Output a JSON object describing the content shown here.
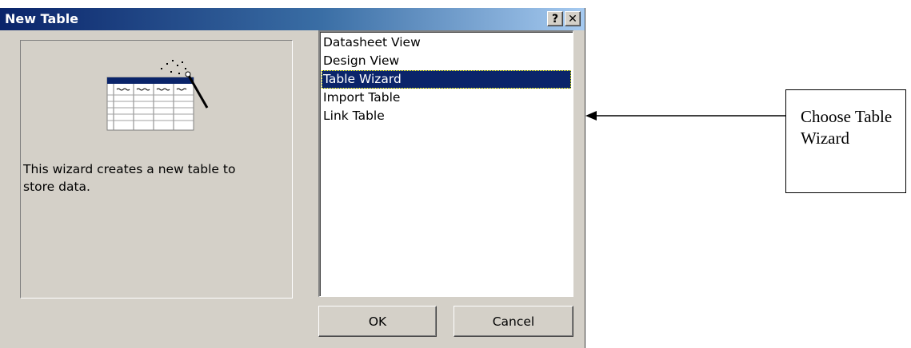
{
  "dialog": {
    "title": "New Table",
    "help_glyph": "?",
    "close_glyph": "✕",
    "description": "This wizard creates a new table to store data.",
    "list_items": [
      {
        "label": "Datasheet View",
        "selected": false
      },
      {
        "label": "Design View",
        "selected": false
      },
      {
        "label": "Table Wizard",
        "selected": true
      },
      {
        "label": "Import Table",
        "selected": false
      },
      {
        "label": "Link Table",
        "selected": false
      }
    ],
    "ok_label": "OK",
    "cancel_label": "Cancel"
  },
  "annotation": {
    "text": "Choose Table Wizard",
    "icon": "left-arrow-icon"
  },
  "colors": {
    "titlebar": "#0a246a",
    "dialog_face": "#d4d0c8",
    "selection": "#0a246a"
  },
  "icons": [
    "help-icon",
    "close-icon",
    "table-wizard-icon",
    "magic-wand-icon"
  ]
}
